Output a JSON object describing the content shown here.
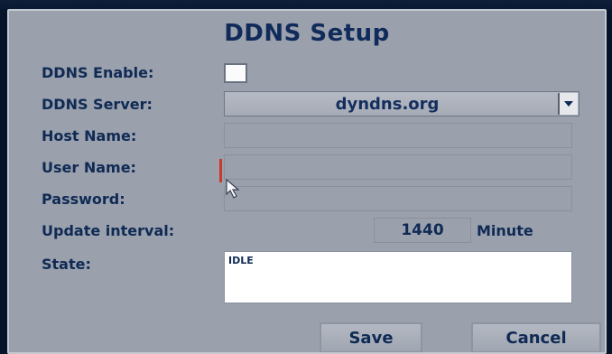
{
  "dialog": {
    "title": "DDNS Setup"
  },
  "fields": {
    "ddns_enable_label": "DDNS Enable:",
    "ddns_enable_checked": false,
    "ddns_server_label": "DDNS Server:",
    "ddns_server_value": "dyndns.org",
    "host_name_label": "Host Name:",
    "host_name_value": "",
    "user_name_label": "User Name:",
    "user_name_value": "",
    "password_label": "Password:",
    "password_value": "",
    "update_interval_label": "Update interval:",
    "update_interval_value": "1440",
    "update_interval_unit": "Minute",
    "state_label": "State:",
    "state_value": "IDLE"
  },
  "buttons": {
    "save_label": "Save",
    "cancel_label": "Cancel"
  },
  "icons": {
    "dropdown": "chevron-down-icon",
    "pointer": "mouse-pointer-icon"
  },
  "colors": {
    "panel_bg": "#9aa0ac",
    "text": "#0f2a54",
    "outer_bg": "#06142a"
  }
}
